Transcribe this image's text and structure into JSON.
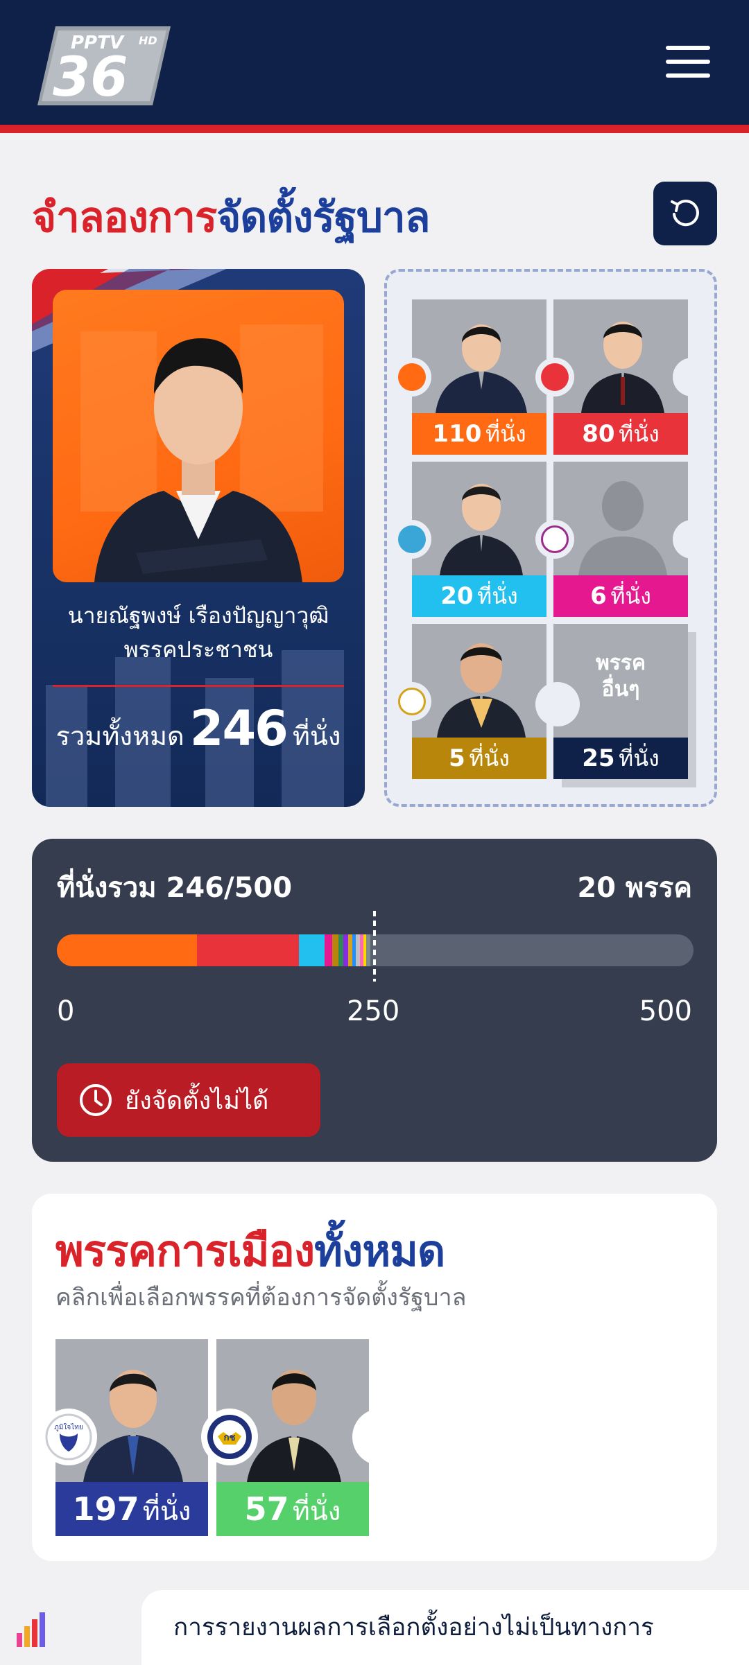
{
  "header": {
    "logo_text_top": "PPTV",
    "logo_text_hd": "HD",
    "logo_text_main": "36",
    "menu_icon": "hamburger-menu-icon"
  },
  "page": {
    "title_part1": "จำลองการ",
    "title_part2": "จัดตั้งรัฐบาล",
    "reset_icon": "reset-icon"
  },
  "prime_minister": {
    "name": "นายณัฐพงษ์ เรืองปัญญาวุฒิ",
    "party": "พรรคประชาชน",
    "total_label": "รวมทั้งหมด",
    "total_seats": "246",
    "unit": "ที่นั่ง"
  },
  "coalition": {
    "parties": [
      {
        "seats": "110",
        "unit": "ที่นั่ง",
        "color": "#ff6a13",
        "logo_color": "#ff6a13"
      },
      {
        "seats": "80",
        "unit": "ที่นั่ง",
        "color": "#e8333a",
        "logo_color": "#e8333a"
      },
      {
        "seats": "20",
        "unit": "ที่นั่ง",
        "color": "#22c0ee",
        "logo_color": "#3aa6d8"
      },
      {
        "seats": "6",
        "unit": "ที่นั่ง",
        "color": "#e5188f",
        "logo_color": "#9b2c8c"
      },
      {
        "seats": "5",
        "unit": "ที่นั่ง",
        "color": "#b8860b",
        "logo_color": "#d4a21b"
      },
      {
        "seats": "25",
        "unit": "ที่นั่ง",
        "color": "#0f2149",
        "other_label_1": "พรรค",
        "other_label_2": "อื่นๆ"
      }
    ]
  },
  "seat_bar": {
    "title": "ที่นั่งรวม 246/500",
    "parties_count": "20 พรรค",
    "total": 500,
    "majority": 250,
    "tick_0": "0",
    "tick_250": "250",
    "tick_500": "500",
    "segments": [
      {
        "seats": 110,
        "color": "#ff6a13"
      },
      {
        "seats": 80,
        "color": "#e8333a"
      },
      {
        "seats": 20,
        "color": "#22c0ee"
      },
      {
        "seats": 6,
        "color": "#e5188f"
      },
      {
        "seats": 5,
        "color": "#b8860b"
      },
      {
        "seats": 4,
        "color": "#2e8b57"
      },
      {
        "seats": 4,
        "color": "#8a2be2"
      },
      {
        "seats": 3,
        "color": "#d4a21b"
      },
      {
        "seats": 3,
        "color": "#1e90ff"
      },
      {
        "seats": 3,
        "color": "#c0c0c0"
      },
      {
        "seats": 3,
        "color": "#ff69b4"
      },
      {
        "seats": 2,
        "color": "#ffd700"
      },
      {
        "seats": 3,
        "color": "#7f8c8d"
      }
    ],
    "status_label": "ยังจัดตั้งไม่ได้",
    "status_icon": "clock-icon"
  },
  "all_parties": {
    "title_part1": "พรรคการเมือง",
    "title_part2": "ทั้งหมด",
    "subtitle": "คลิกเพื่อเลือกพรรคที่ต้องการจัดตั้งรัฐบาล",
    "parties": [
      {
        "seats": "197",
        "unit": "ที่นั่ง",
        "color": "#2a3b9c",
        "logo_text": "ภูมิใจไทย"
      },
      {
        "seats": "57",
        "unit": "ที่นั่ง",
        "color": "#55d06a",
        "logo_text": "กช"
      }
    ]
  },
  "footer": {
    "notice": "การรายงานผลการเลือกตั้งอย่างไม่เป็นทางการ",
    "icon": "chart-bars-icon"
  }
}
